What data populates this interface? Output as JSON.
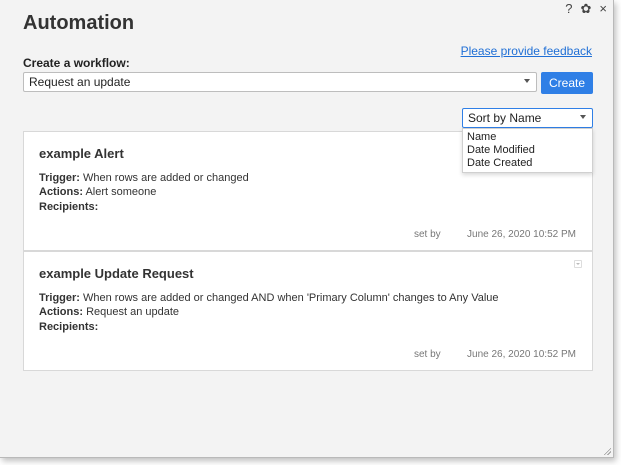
{
  "window": {
    "title": "Automation",
    "controls": {
      "help": "?",
      "settings": "✿",
      "close": "×"
    }
  },
  "feedback_link": "Please provide feedback",
  "create": {
    "label": "Create a workflow:",
    "selected": "Request an update",
    "button": "Create"
  },
  "sort": {
    "selected": "Sort by Name",
    "options": [
      "Name",
      "Date Modified",
      "Date Created"
    ]
  },
  "workflows": [
    {
      "name": "example Alert",
      "trigger_label": "Trigger:",
      "trigger": "When rows are added or changed",
      "actions_label": "Actions:",
      "actions": "Alert someone",
      "recipients_label": "Recipients:",
      "recipients": "",
      "set_by": "set by",
      "date": "June 26, 2020 10:52 PM"
    },
    {
      "name": "example Update Request",
      "trigger_label": "Trigger:",
      "trigger": "When rows are added or changed AND when 'Primary Column' changes to Any Value",
      "actions_label": "Actions:",
      "actions": "Request an update",
      "recipients_label": "Recipients:",
      "recipients": "",
      "set_by": "set by",
      "date": "June 26, 2020 10:52 PM"
    }
  ]
}
